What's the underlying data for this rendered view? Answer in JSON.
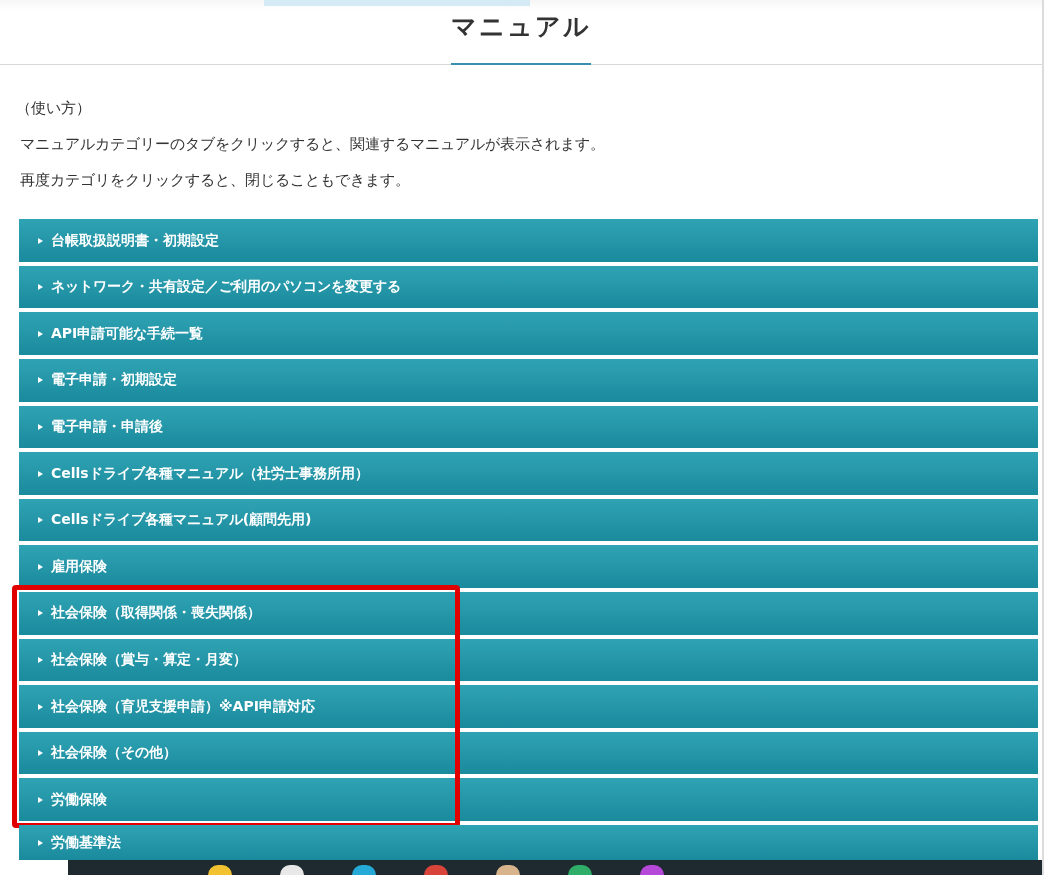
{
  "header": {
    "title": "マニュアル"
  },
  "instructions": [
    "（使い方）",
    "マニュアルカテゴリーのタブをクリックすると、関連するマニュアルが表示されます。",
    "再度カテゴリをクリックすると、閉じることもできます。"
  ],
  "categories": [
    {
      "label": "台帳取扱説明書・初期設定",
      "highlighted": false
    },
    {
      "label": "ネットワーク・共有設定／ご利用のパソコンを変更する",
      "highlighted": false
    },
    {
      "label": "API申請可能な手続一覧",
      "highlighted": false
    },
    {
      "label": "電子申請・初期設定",
      "highlighted": false
    },
    {
      "label": "電子申請・申請後",
      "highlighted": false
    },
    {
      "label": "Cellsドライブ各種マニュアル（社労士事務所用）",
      "highlighted": false
    },
    {
      "label": "Cellsドライブ各種マニュアル(顧問先用)",
      "highlighted": false
    },
    {
      "label": "雇用保険",
      "highlighted": false
    },
    {
      "label": "社会保険（取得関係・喪失関係）",
      "highlighted": true
    },
    {
      "label": "社会保険（賞与・算定・月変）",
      "highlighted": true
    },
    {
      "label": "社会保険（育児支援申請）※API申請対応",
      "highlighted": true
    },
    {
      "label": "社会保険（その他）",
      "highlighted": true
    },
    {
      "label": "労働保険",
      "highlighted": true
    },
    {
      "label": "労働基準法",
      "highlighted": false
    }
  ]
}
